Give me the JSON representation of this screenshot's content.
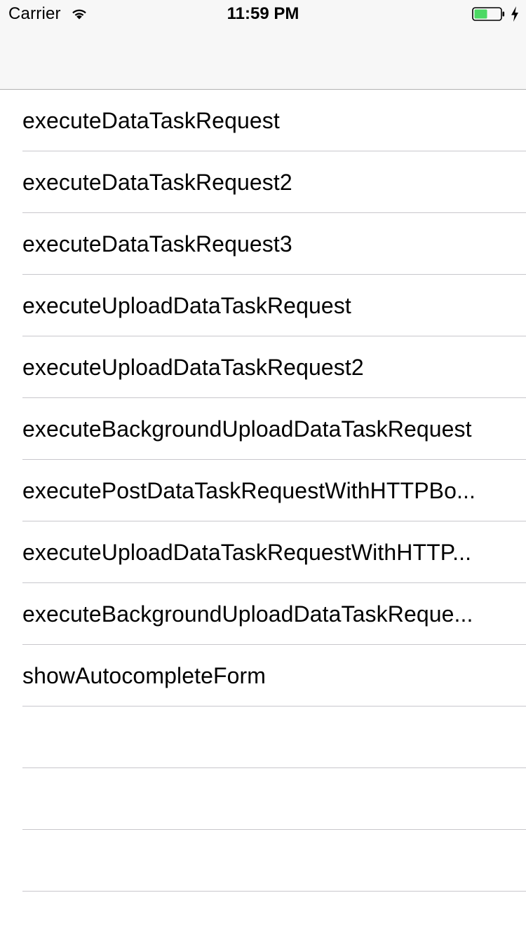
{
  "status_bar": {
    "carrier": "Carrier",
    "time": "11:59 PM",
    "battery_level": 0.5,
    "charging": true,
    "battery_color": "#4cd964"
  },
  "navbar": {
    "background": "#f7f7f7"
  },
  "table": {
    "rows": [
      {
        "label": "executeDataTaskRequest"
      },
      {
        "label": "executeDataTaskRequest2"
      },
      {
        "label": "executeDataTaskRequest3"
      },
      {
        "label": "executeUploadDataTaskRequest"
      },
      {
        "label": "executeUploadDataTaskRequest2"
      },
      {
        "label": "executeBackgroundUploadDataTaskRequest"
      },
      {
        "label": "executePostDataTaskRequestWithHTTPBo..."
      },
      {
        "label": "executeUploadDataTaskRequestWithHTTP..."
      },
      {
        "label": "executeBackgroundUploadDataTaskReque..."
      },
      {
        "label": "showAutocompleteForm"
      },
      {
        "label": ""
      },
      {
        "label": ""
      },
      {
        "label": ""
      },
      {
        "label": ""
      }
    ]
  }
}
